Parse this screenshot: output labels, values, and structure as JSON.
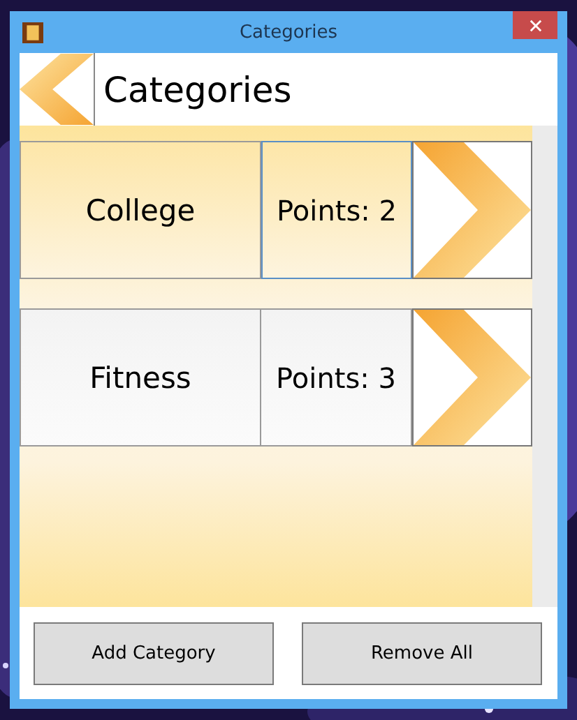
{
  "window": {
    "title": "Categories"
  },
  "header": {
    "title": "Categories"
  },
  "categories": [
    {
      "name": "College",
      "points": "Points: 2",
      "selected": true
    },
    {
      "name": "Fitness",
      "points": "Points: 3",
      "selected": false
    }
  ],
  "buttons": [
    "Add Category",
    "Remove All"
  ]
}
